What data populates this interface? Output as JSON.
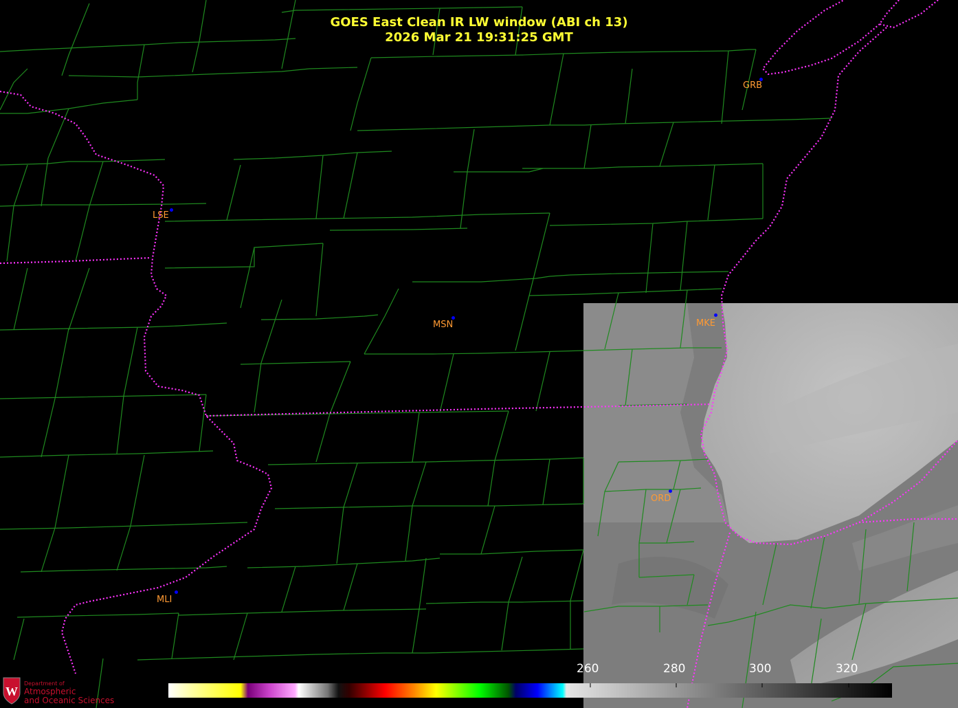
{
  "header": {
    "title_line1": "GOES East Clean IR LW window (ABI ch 13)",
    "title_line2": "2026 Mar 21  19:31:25 GMT"
  },
  "stations": [
    {
      "id": "GRB"
    },
    {
      "id": "LSE"
    },
    {
      "id": "MSN"
    },
    {
      "id": "MKE"
    },
    {
      "id": "ORD"
    },
    {
      "id": "MLI"
    }
  ],
  "colorbar": {
    "tick_labels": [
      "260",
      "280",
      "300",
      "320"
    ]
  },
  "logo": {
    "line1": "Department of",
    "line2": "Atmospheric",
    "line3": "and Oceanic Sciences"
  },
  "colors": {
    "title": "#ffff33",
    "county_lines": "#1f8a1f",
    "state_lines": "#ff33ff",
    "station_label": "#ff9a33",
    "station_dot": "#0000ff"
  }
}
